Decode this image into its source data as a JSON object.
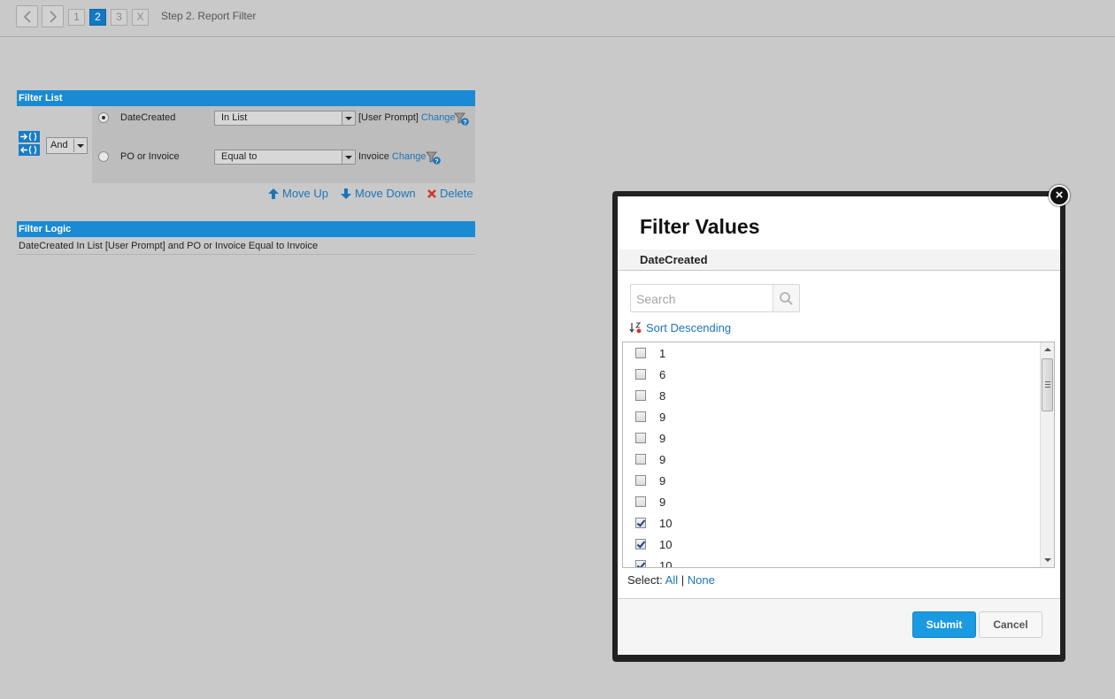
{
  "wizard": {
    "steps": [
      "1",
      "2",
      "3",
      "X"
    ],
    "active_step": "2",
    "title": "Step 2. Report Filter"
  },
  "filter_list": {
    "header": "Filter List",
    "logic_operator": "And",
    "rows": [
      {
        "field": "DateCreated",
        "operator": "In List",
        "value": "[User Prompt]",
        "change": "Change",
        "selected": true
      },
      {
        "field": "PO or Invoice",
        "operator": "Equal to",
        "value": "Invoice",
        "change": "Change",
        "selected": false
      }
    ],
    "actions": {
      "move_up": "Move Up",
      "move_down": "Move Down",
      "delete": "Delete"
    }
  },
  "filter_logic": {
    "header": "Filter Logic",
    "text": "DateCreated In List [User Prompt] and PO or Invoice Equal to Invoice"
  },
  "modal": {
    "title": "Filter Values",
    "field": "DateCreated",
    "search_placeholder": "Search",
    "sort_label": "Sort Descending",
    "items": [
      {
        "label": "1",
        "checked": false
      },
      {
        "label": "6",
        "checked": false
      },
      {
        "label": "8",
        "checked": false
      },
      {
        "label": "9",
        "checked": false
      },
      {
        "label": "9",
        "checked": false
      },
      {
        "label": "9",
        "checked": false
      },
      {
        "label": "9",
        "checked": false
      },
      {
        "label": "9",
        "checked": false
      },
      {
        "label": "10",
        "checked": true
      },
      {
        "label": "10",
        "checked": true
      },
      {
        "label": "10",
        "checked": true
      }
    ],
    "select_label": "Select:",
    "select_all": "All",
    "select_separator": "|",
    "select_none": "None",
    "submit": "Submit",
    "cancel": "Cancel",
    "close": "×"
  },
  "colors": {
    "accent": "#1a8ad4",
    "link": "#1c74b9",
    "submit": "#1a9ae0",
    "background": "#c9c9c9"
  }
}
